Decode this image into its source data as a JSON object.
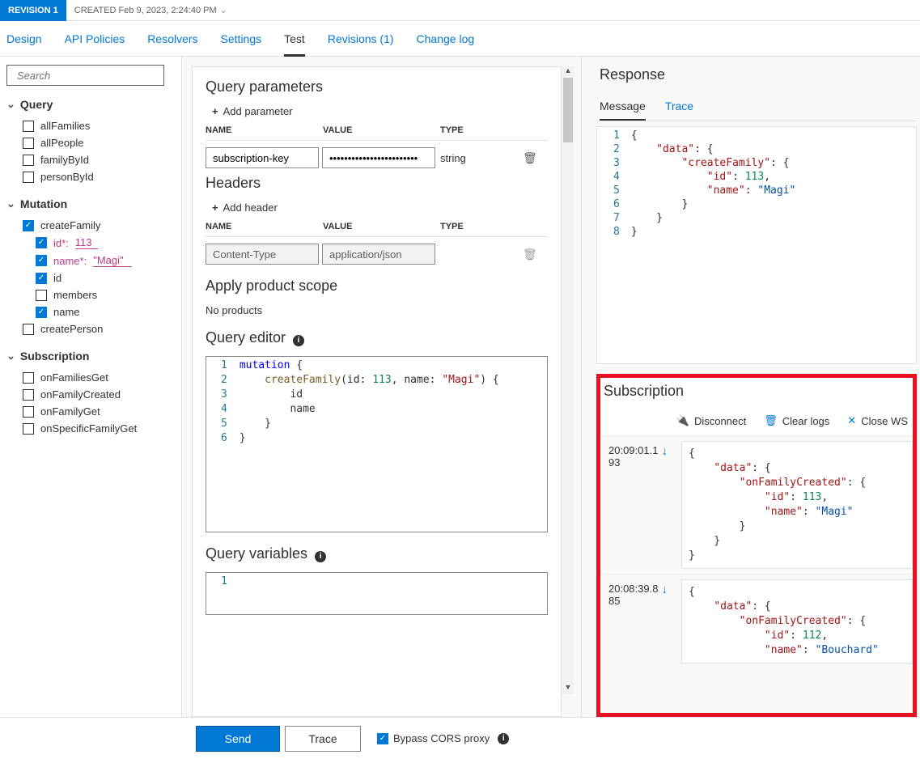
{
  "revision": {
    "badge": "REVISION 1",
    "created": "CREATED Feb 9, 2023, 2:24:40 PM"
  },
  "tabs": {
    "design": "Design",
    "api_policies": "API Policies",
    "resolvers": "Resolvers",
    "settings": "Settings",
    "test": "Test",
    "revisions": "Revisions (1)",
    "changelog": "Change log"
  },
  "search": {
    "placeholder": "Search"
  },
  "tree": {
    "query": {
      "label": "Query",
      "items": [
        "allFamilies",
        "allPeople",
        "familyById",
        "personById"
      ]
    },
    "mutation": {
      "label": "Mutation",
      "create_family": {
        "label": "createFamily",
        "params": {
          "id_label": "id*:",
          "id_value": "113",
          "name_label": "name*:",
          "name_value": "\"Magi\""
        },
        "fields": {
          "id": "id",
          "members": "members",
          "name": "name"
        }
      },
      "create_person": "createPerson"
    },
    "subscription": {
      "label": "Subscription",
      "items": [
        "onFamiliesGet",
        "onFamilyCreated",
        "onFamilyGet",
        "onSpecificFamilyGet"
      ]
    }
  },
  "center": {
    "qp_title": "Query parameters",
    "add_param": "Add parameter",
    "hdr_name": "NAME",
    "hdr_value": "VALUE",
    "hdr_type": "TYPE",
    "qp_row": {
      "name": "subscription-key",
      "value": "••••••••••••••••••••••••",
      "type": "string"
    },
    "headers_title": "Headers",
    "add_header": "Add header",
    "h_row": {
      "name": "Content-Type",
      "value": "application/json"
    },
    "scope_title": "Apply product scope",
    "no_products": "No products",
    "qe_title": "Query editor",
    "qv_title": "Query variables",
    "code": {
      "l1": "mutation {",
      "l2": "    createFamily(id: 113, name: \"Magi\") {",
      "l3": "        id",
      "l4": "        name",
      "l5": "    }",
      "l6": "}"
    }
  },
  "response": {
    "title": "Response",
    "tab_message": "Message",
    "tab_trace": "Trace",
    "json": {
      "data_key": "\"data\"",
      "cf_key": "\"createFamily\"",
      "id_key": "\"id\"",
      "id_val": "113",
      "name_key": "\"name\"",
      "name_val": "\"Magi\""
    }
  },
  "subscription": {
    "title": "Subscription",
    "disconnect": "Disconnect",
    "clear_logs": "Clear logs",
    "close_ws": "Close WS",
    "events": [
      {
        "time1": "20:09:01.1",
        "time2": "93",
        "ofc_key": "\"onFamilyCreated\"",
        "id_val": "113",
        "name_val": "\"Magi\""
      },
      {
        "time1": "20:08:39.8",
        "time2": "85",
        "ofc_key": "\"onFamilyCreated\"",
        "id_val": "112",
        "name_val": "\"Bouchard\""
      }
    ]
  },
  "footer": {
    "send": "Send",
    "trace": "Trace",
    "bypass": "Bypass CORS proxy"
  }
}
